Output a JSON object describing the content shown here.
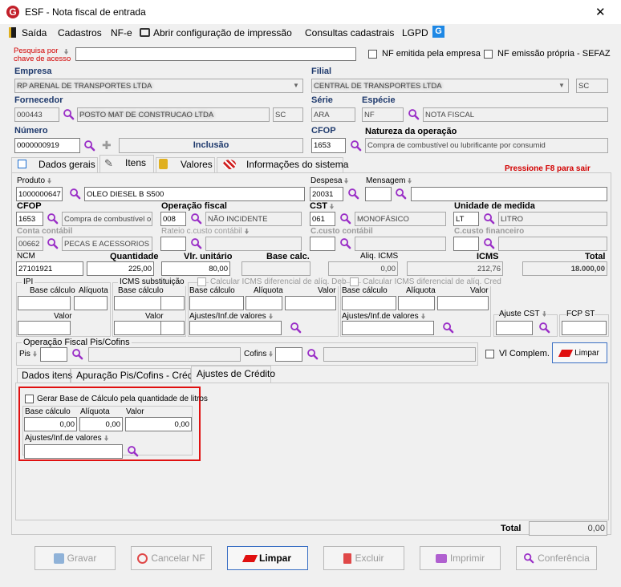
{
  "window": {
    "title": "ESF - Nota fiscal de entrada"
  },
  "menu": [
    "Saída",
    "Cadastros",
    "NF-e",
    "Abrir configuração de impressão",
    "Consultas cadastrais",
    "LGPD"
  ],
  "search": {
    "label_1": "Pesquisa por",
    "label_2": "chave de acesso",
    "value": "",
    "cb_emitida": "NF emitida pela empresa",
    "cb_propria": "NF emissão própria - SEFAZ"
  },
  "header": {
    "empresa_label": "Empresa",
    "empresa_value": "RP ARENAL DE TRANSPORTES LTDA",
    "filial_label": "Filial",
    "filial_value": "CENTRAL DE TRANSPORTES LTDA",
    "filial_uf": "SC",
    "fornecedor_label": "Fornecedor",
    "fornecedor_code": "000443",
    "fornecedor_name": "POSTO MAT DE CONSTRUCAO LTDA",
    "fornecedor_uf": "SC",
    "serie_label": "Série",
    "serie_value": "ARA",
    "especie_label": "Espécie",
    "especie_code": "NF",
    "especie_desc": "NOTA FISCAL",
    "numero_label": "Número",
    "numero_value": "0000000919",
    "status": "Inclusão",
    "cfop_label": "CFOP",
    "cfop_value": "1653",
    "natureza_label": "Natureza da operação",
    "natureza_value": "Compra de combustível ou lubrificante por consumid"
  },
  "tabs": [
    "Dados gerais",
    "Itens",
    "Valores",
    "Informações do sistema"
  ],
  "f8_hint": "Pressione F8 para sair",
  "item": {
    "produto_label": "Produto",
    "produto_code": "1000000647",
    "produto_desc": "OLEO DIESEL B S500",
    "despesa_label": "Despesa",
    "despesa_value": "20031",
    "mensagem_label": "Mensagem",
    "cfop_label": "CFOP",
    "cfop_value": "1653",
    "cfop_desc": "Compra de combustível o",
    "opfiscal_label": "Operação fiscal",
    "opfiscal_code": "008",
    "opfiscal_desc": "NÃO INCIDENTE",
    "cst_label": "CST",
    "cst_code": "061",
    "cst_desc": "MONOFÁSICO",
    "um_label": "Unidade de medida",
    "um_code": "LT",
    "um_desc": "LITRO",
    "cc_label": "Conta contábil",
    "cc_code": "00662",
    "cc_desc": "PECAS E ACESSORIOS",
    "rateio_label": "Rateio c.custo contábil",
    "ccusto_label": "C.custo contábil",
    "ccfin_label": "C.custo financeiro",
    "ncm_label": "NCM",
    "ncm_value": "27101921",
    "qtd_label": "Quantidade",
    "qtd_value": "225,00",
    "vlr_label": "Vlr. unitário",
    "vlr_value": "80,00",
    "base_label": "Base calc.",
    "aliq_label": "Aliq. ICMS",
    "aliq_value": "0,00",
    "icms_label": "ICMS",
    "icms_value": "212,76",
    "total_label": "Total",
    "total_value": "18.000,00"
  },
  "ipi": {
    "title": "IPI",
    "base": "Base cálculo",
    "aliq": "Alíquota",
    "valor": "Valor"
  },
  "icmsst": {
    "title": "ICMS substituição",
    "base": "Base cálculo",
    "valor": "Valor"
  },
  "difdeb": {
    "title": "Calcular ICMS diferencial de alíq. Deb",
    "base": "Base cálculo",
    "aliq": "Alíquota",
    "valor": "Valor",
    "ajustes": "Ajustes/Inf.de valores"
  },
  "difcred": {
    "title": "Calcular ICMS diferencial de alíq. Cred",
    "base": "Base cálculo",
    "aliq": "Alíquota",
    "valor": "Valor",
    "ajustes": "Ajustes/Inf.de valores"
  },
  "ajuste_cst": "Ajuste CST",
  "fcp_st": "FCP ST",
  "piscofins": {
    "title": "Operação Fiscal Pis/Cofins",
    "pis": "Pis",
    "cofins": "Cofins",
    "vl_complem": "Vl Complem.",
    "limpar": "Limpar"
  },
  "subtabs": [
    "Dados itens",
    "Apuração Pis/Cofins - Crédito",
    "Ajustes de Crédito"
  ],
  "credito": {
    "checkbox": "Gerar Base de Cálculo pela quantidade de litros",
    "base_label": "Base cálculo",
    "aliq_label": "Alíquota",
    "valor_label": "Valor",
    "base_value": "0,00",
    "aliq_value": "0,00",
    "valor_value": "0,00",
    "ajustes_label": "Ajustes/Inf.de valores"
  },
  "footer_total": {
    "label": "Total",
    "value": "0,00"
  },
  "buttons": {
    "gravar": "Gravar",
    "cancelar": "Cancelar NF",
    "limpar": "Limpar",
    "excluir": "Excluir",
    "imprimir": "Imprimir",
    "conferencia": "Conferência"
  },
  "colors": {
    "accent_purple": "#9a2fc7",
    "label_blue": "#1f3a6d",
    "hint_red": "#d20000",
    "highlight_red": "#e01010",
    "btn_focus": "#3a6fc4"
  }
}
